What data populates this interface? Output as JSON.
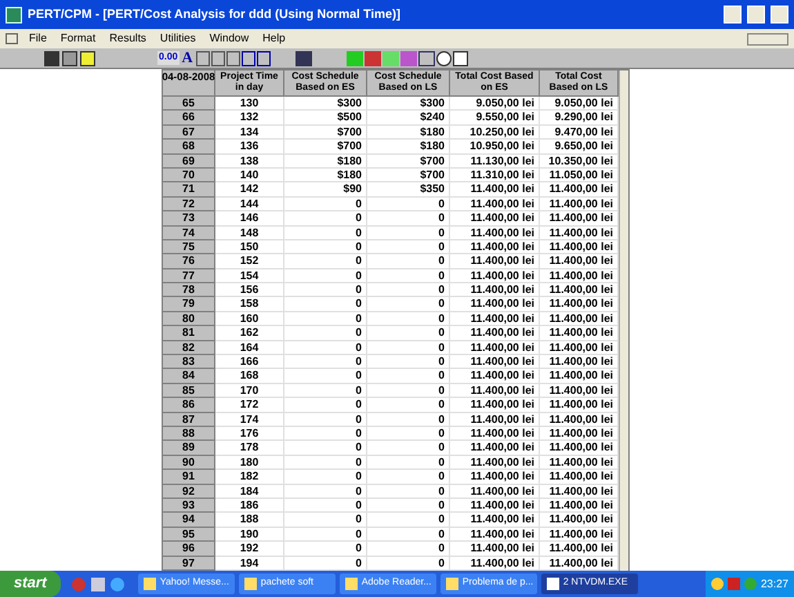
{
  "window": {
    "title": "PERT/CPM - [PERT/Cost Analysis for ddd (Using Normal Time)]"
  },
  "menu": [
    "File",
    "Format",
    "Results",
    "Utilities",
    "Window",
    "Help"
  ],
  "toolbar": {
    "decimal_label": "0.00",
    "font_label": "A"
  },
  "table": {
    "corner": "04-08-2008",
    "columns": [
      "Project Time in day",
      "Cost Schedule Based on ES",
      "Cost Schedule Based on LS",
      "Total Cost Based on ES",
      "Total Cost Based on LS"
    ],
    "rows": [
      {
        "header": "65",
        "cells": [
          "130",
          "$300",
          "$300",
          "9.050,00 lei",
          "9.050,00 lei"
        ]
      },
      {
        "header": "66",
        "cells": [
          "132",
          "$500",
          "$240",
          "9.550,00 lei",
          "9.290,00 lei"
        ]
      },
      {
        "header": "67",
        "cells": [
          "134",
          "$700",
          "$180",
          "10.250,00 lei",
          "9.470,00 lei"
        ]
      },
      {
        "header": "68",
        "cells": [
          "136",
          "$700",
          "$180",
          "10.950,00 lei",
          "9.650,00 lei"
        ]
      },
      {
        "header": "69",
        "cells": [
          "138",
          "$180",
          "$700",
          "11.130,00 lei",
          "10.350,00 lei"
        ]
      },
      {
        "header": "70",
        "cells": [
          "140",
          "$180",
          "$700",
          "11.310,00 lei",
          "11.050,00 lei"
        ]
      },
      {
        "header": "71",
        "cells": [
          "142",
          "$90",
          "$350",
          "11.400,00 lei",
          "11.400,00 lei"
        ]
      },
      {
        "header": "72",
        "cells": [
          "144",
          "0",
          "0",
          "11.400,00 lei",
          "11.400,00 lei"
        ]
      },
      {
        "header": "73",
        "cells": [
          "146",
          "0",
          "0",
          "11.400,00 lei",
          "11.400,00 lei"
        ]
      },
      {
        "header": "74",
        "cells": [
          "148",
          "0",
          "0",
          "11.400,00 lei",
          "11.400,00 lei"
        ]
      },
      {
        "header": "75",
        "cells": [
          "150",
          "0",
          "0",
          "11.400,00 lei",
          "11.400,00 lei"
        ]
      },
      {
        "header": "76",
        "cells": [
          "152",
          "0",
          "0",
          "11.400,00 lei",
          "11.400,00 lei"
        ]
      },
      {
        "header": "77",
        "cells": [
          "154",
          "0",
          "0",
          "11.400,00 lei",
          "11.400,00 lei"
        ]
      },
      {
        "header": "78",
        "cells": [
          "156",
          "0",
          "0",
          "11.400,00 lei",
          "11.400,00 lei"
        ]
      },
      {
        "header": "79",
        "cells": [
          "158",
          "0",
          "0",
          "11.400,00 lei",
          "11.400,00 lei"
        ]
      },
      {
        "header": "80",
        "cells": [
          "160",
          "0",
          "0",
          "11.400,00 lei",
          "11.400,00 lei"
        ]
      },
      {
        "header": "81",
        "cells": [
          "162",
          "0",
          "0",
          "11.400,00 lei",
          "11.400,00 lei"
        ]
      },
      {
        "header": "82",
        "cells": [
          "164",
          "0",
          "0",
          "11.400,00 lei",
          "11.400,00 lei"
        ]
      },
      {
        "header": "83",
        "cells": [
          "166",
          "0",
          "0",
          "11.400,00 lei",
          "11.400,00 lei"
        ]
      },
      {
        "header": "84",
        "cells": [
          "168",
          "0",
          "0",
          "11.400,00 lei",
          "11.400,00 lei"
        ]
      },
      {
        "header": "85",
        "cells": [
          "170",
          "0",
          "0",
          "11.400,00 lei",
          "11.400,00 lei"
        ]
      },
      {
        "header": "86",
        "cells": [
          "172",
          "0",
          "0",
          "11.400,00 lei",
          "11.400,00 lei"
        ]
      },
      {
        "header": "87",
        "cells": [
          "174",
          "0",
          "0",
          "11.400,00 lei",
          "11.400,00 lei"
        ]
      },
      {
        "header": "88",
        "cells": [
          "176",
          "0",
          "0",
          "11.400,00 lei",
          "11.400,00 lei"
        ]
      },
      {
        "header": "89",
        "cells": [
          "178",
          "0",
          "0",
          "11.400,00 lei",
          "11.400,00 lei"
        ]
      },
      {
        "header": "90",
        "cells": [
          "180",
          "0",
          "0",
          "11.400,00 lei",
          "11.400,00 lei"
        ]
      },
      {
        "header": "91",
        "cells": [
          "182",
          "0",
          "0",
          "11.400,00 lei",
          "11.400,00 lei"
        ]
      },
      {
        "header": "92",
        "cells": [
          "184",
          "0",
          "0",
          "11.400,00 lei",
          "11.400,00 lei"
        ]
      },
      {
        "header": "93",
        "cells": [
          "186",
          "0",
          "0",
          "11.400,00 lei",
          "11.400,00 lei"
        ]
      },
      {
        "header": "94",
        "cells": [
          "188",
          "0",
          "0",
          "11.400,00 lei",
          "11.400,00 lei"
        ]
      },
      {
        "header": "95",
        "cells": [
          "190",
          "0",
          "0",
          "11.400,00 lei",
          "11.400,00 lei"
        ]
      },
      {
        "header": "96",
        "cells": [
          "192",
          "0",
          "0",
          "11.400,00 lei",
          "11.400,00 lei"
        ]
      },
      {
        "header": "97",
        "cells": [
          "194",
          "0",
          "0",
          "11.400,00 lei",
          "11.400,00 lei"
        ]
      }
    ]
  },
  "taskbar": {
    "start": "start",
    "tasks": [
      {
        "label": "Yahoo! Messe...",
        "selected": false
      },
      {
        "label": "pachete soft",
        "selected": false
      },
      {
        "label": "Adobe Reader...",
        "selected": false
      },
      {
        "label": "Problema de p...",
        "selected": false
      },
      {
        "label": "2 NTVDM.EXE",
        "selected": true
      }
    ],
    "clock": "23:27"
  }
}
